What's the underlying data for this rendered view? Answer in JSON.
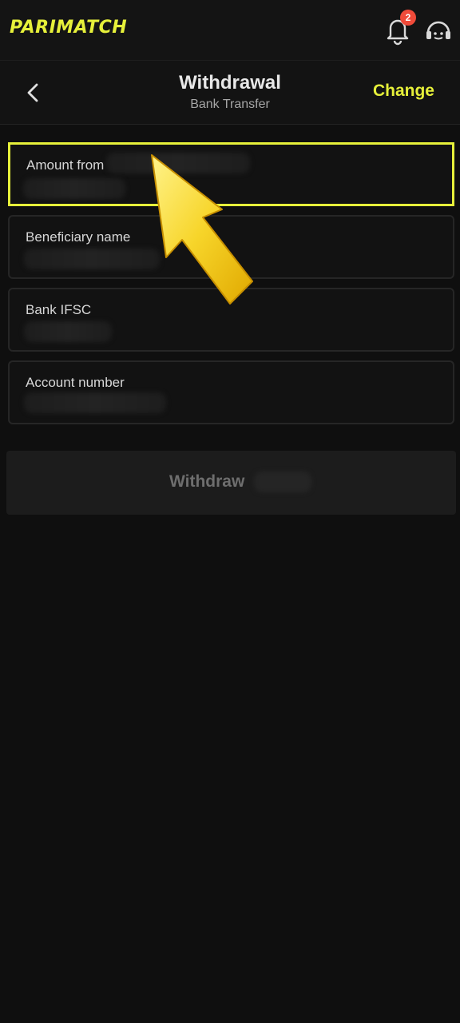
{
  "app": {
    "brand": "PARIMATCH",
    "notification_count": "2",
    "accent_color": "#e6f03a"
  },
  "header": {
    "title": "Withdrawal",
    "subtitle": "Bank Transfer",
    "change_label": "Change"
  },
  "form": {
    "fields": [
      {
        "label": "Amount from"
      },
      {
        "label": "Beneficiary name"
      },
      {
        "label": "Bank IFSC"
      },
      {
        "label": "Account number"
      }
    ],
    "submit_label": "Withdraw"
  },
  "icons": [
    "back-chevron-icon",
    "bell-icon",
    "support-headset-icon",
    "pointer-arrow-icon"
  ]
}
